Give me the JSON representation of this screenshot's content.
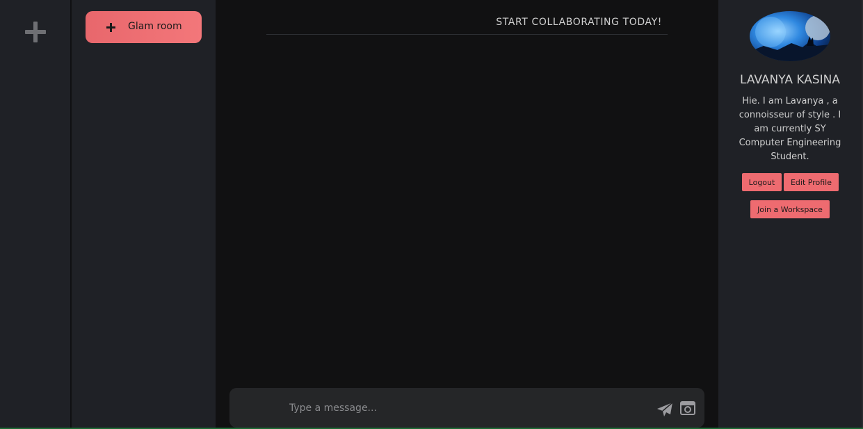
{
  "rail": {
    "add_icon": "plus-icon"
  },
  "rooms": {
    "items": [
      {
        "label": "Glam room",
        "icon": "plus-icon",
        "color": "#f07175"
      }
    ]
  },
  "chat": {
    "title": "START COLLABORATING TODAY!",
    "composer": {
      "placeholder": "Type a message...",
      "send_icon": "send-icon",
      "camera_icon": "camera-icon"
    }
  },
  "profile": {
    "name": "LAVANYA KASINA",
    "bio": "Hie. I am Lavanya , a connoisseur of style . I am currently SY Computer Engineering Student.",
    "buttons": {
      "logout": "Logout",
      "edit": "Edit Profile",
      "join": "Join a Workspace"
    }
  },
  "colors": {
    "accent": "#ee6b70",
    "panel": "#1f2126",
    "main_bg": "#111112"
  }
}
